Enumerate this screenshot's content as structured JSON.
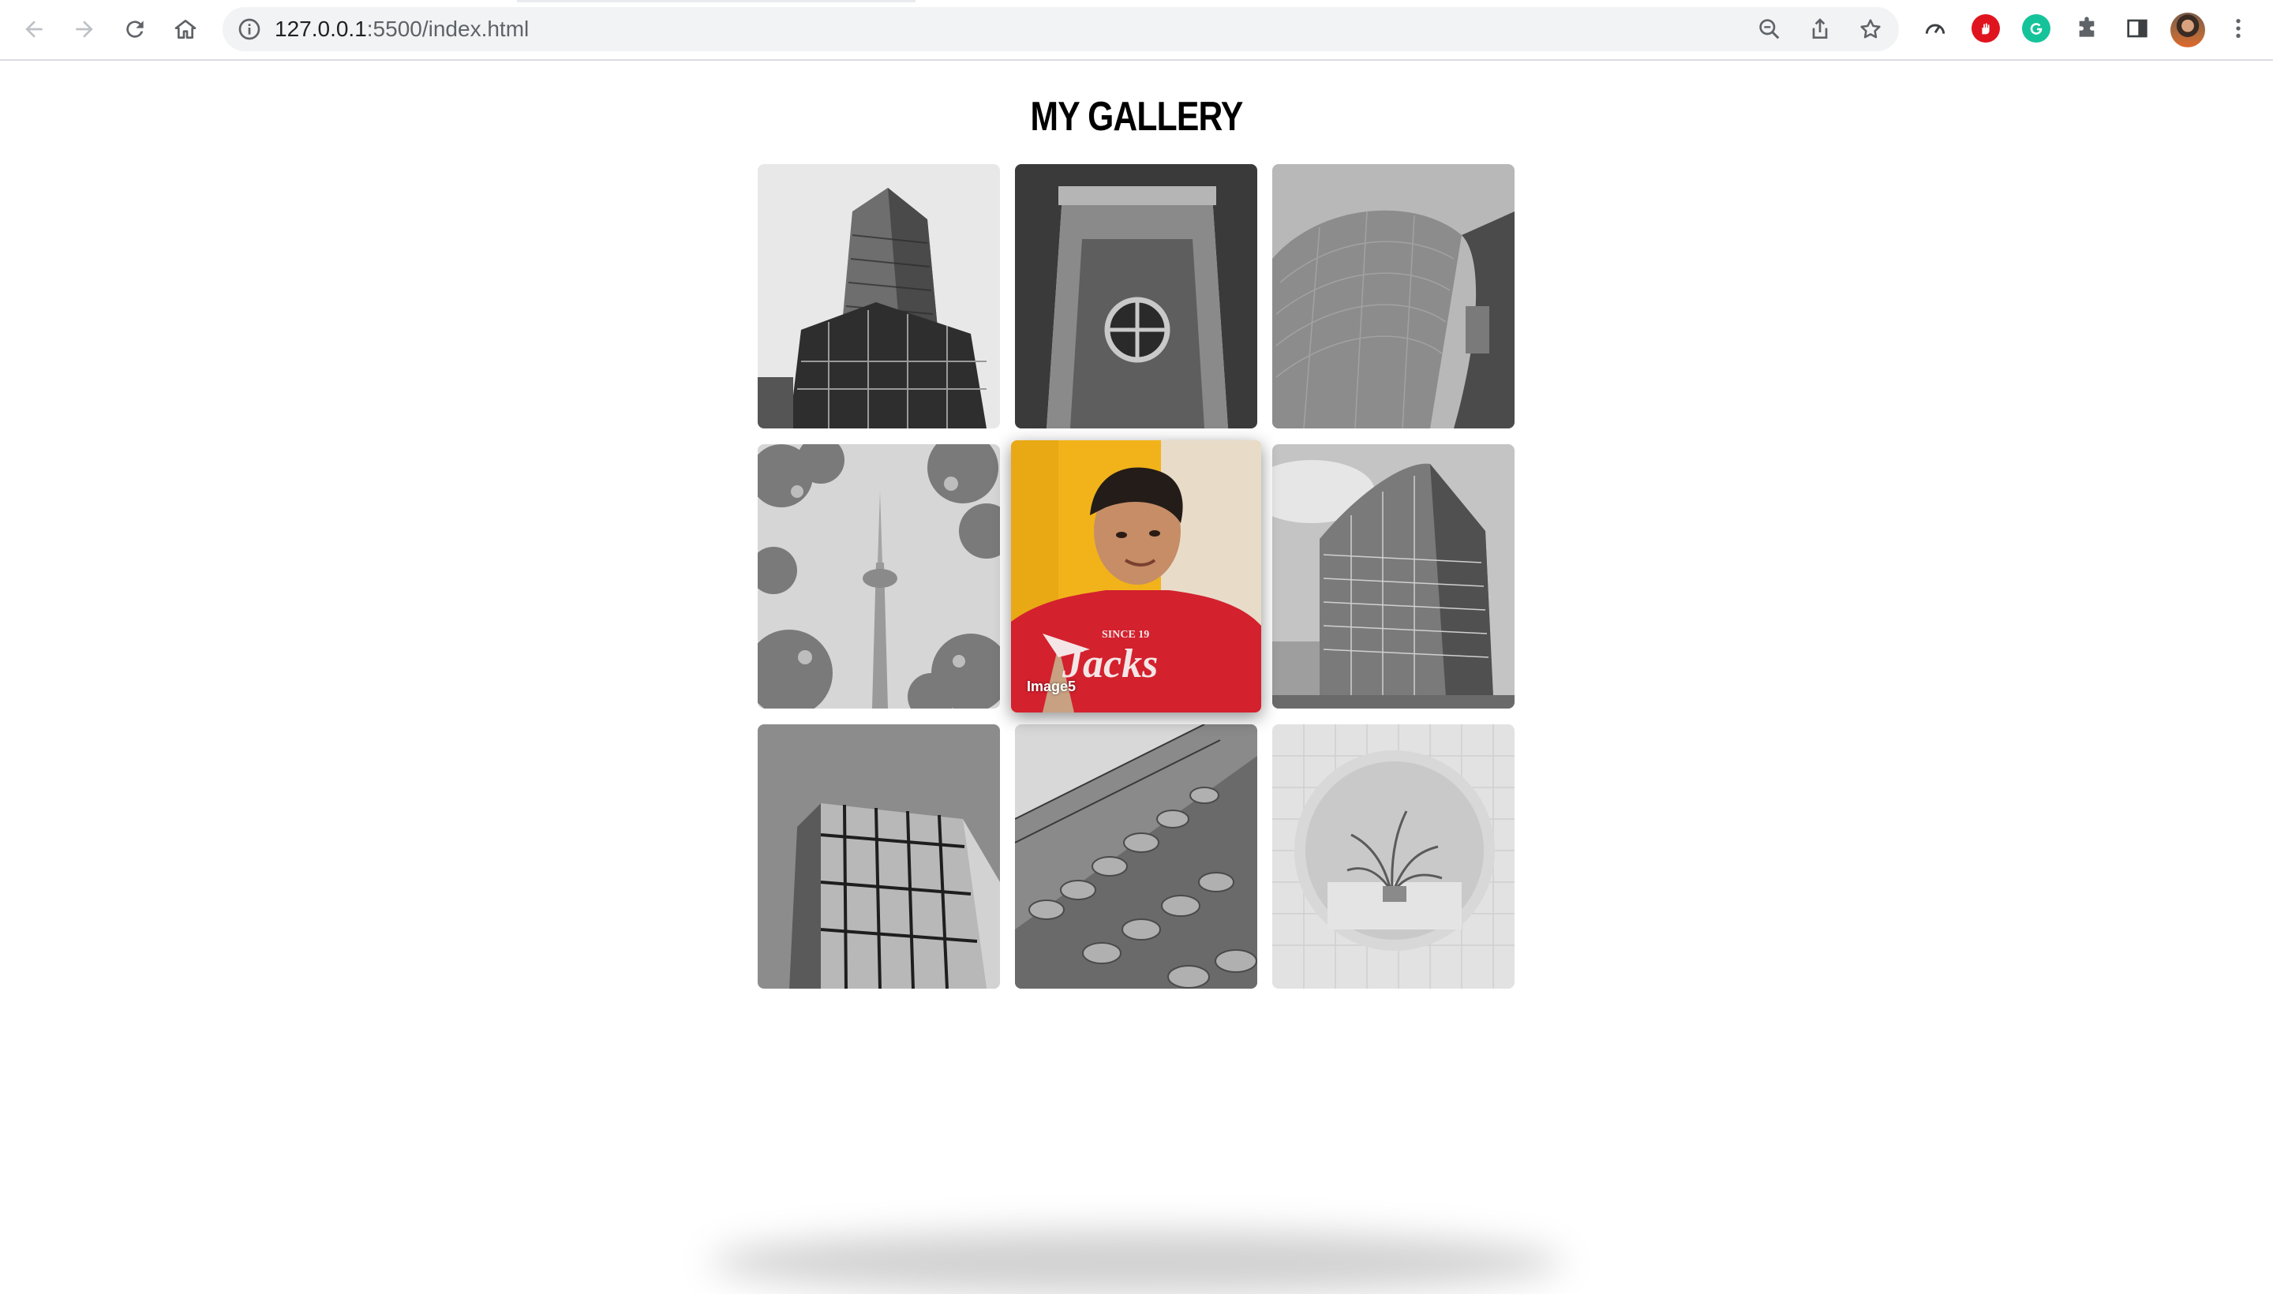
{
  "browser": {
    "url_host": "127.0.0.1",
    "url_rest": ":5500/index.html"
  },
  "page": {
    "title": "MY GALLERY"
  },
  "gallery": {
    "images": [
      {
        "id": "Image1",
        "subject": "skyscraper-tower",
        "grayscale": true
      },
      {
        "id": "Image2",
        "subject": "round-window-facade",
        "grayscale": true
      },
      {
        "id": "Image3",
        "subject": "curved-metal-building",
        "grayscale": true
      },
      {
        "id": "Image4",
        "subject": "tower-cherry-blossoms",
        "grayscale": true
      },
      {
        "id": "Image5",
        "subject": "portrait-red-tshirt",
        "grayscale": false,
        "hovered": true,
        "caption": "Image5"
      },
      {
        "id": "Image6",
        "subject": "glass-office-building",
        "grayscale": true
      },
      {
        "id": "Image7",
        "subject": "modern-glass-corner",
        "grayscale": true
      },
      {
        "id": "Image8",
        "subject": "ornate-building-columns",
        "grayscale": true
      },
      {
        "id": "Image9",
        "subject": "round-room-plant",
        "grayscale": true
      }
    ]
  },
  "colors": {
    "tshirt": "#d3212e",
    "background_yellow": "#f2b31a",
    "grammarly": "#15c39a",
    "adblock": "#e0141e"
  }
}
